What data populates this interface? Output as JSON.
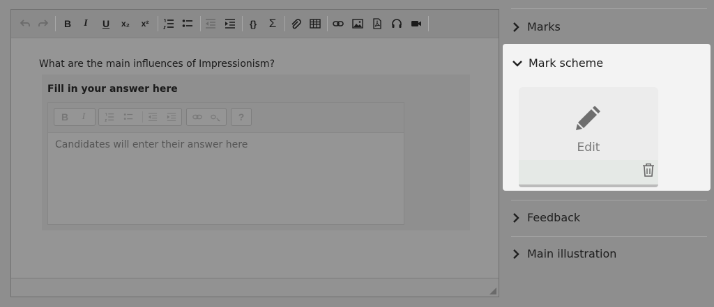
{
  "editor": {
    "question": "What are the main influences of Impressionism?",
    "toolbar_icons": [
      "undo-icon",
      "redo-icon",
      "bold-icon",
      "italic-icon",
      "underline-icon",
      "subscript-icon",
      "superscript-icon",
      "ordered-list-icon",
      "bullet-list-icon",
      "outdent-icon",
      "indent-icon",
      "code-braces-icon",
      "sigma-icon",
      "paperclip-icon",
      "table-icon",
      "link-icon",
      "image-icon",
      "pdf-icon",
      "audio-icon",
      "video-icon"
    ]
  },
  "answer": {
    "title": "Fill in your answer here",
    "placeholder": "Candidates will enter their answer here",
    "toolbar": {
      "bold": "B",
      "italic": "I",
      "help": "?"
    }
  },
  "toolbar": {
    "bold": "B",
    "italic": "I",
    "underline": "U",
    "subscript": "x₂",
    "superscript": "x²",
    "braces": "{}",
    "sigma": "Σ"
  },
  "sidebar": {
    "marks": "Marks",
    "mark_scheme": "Mark scheme",
    "edit_label": "Edit",
    "feedback": "Feedback",
    "main_illustration": "Main illustration"
  },
  "colors": {
    "overlay": "#8e8e8e",
    "panel": "#f3f3f3",
    "card": "#ececec"
  }
}
